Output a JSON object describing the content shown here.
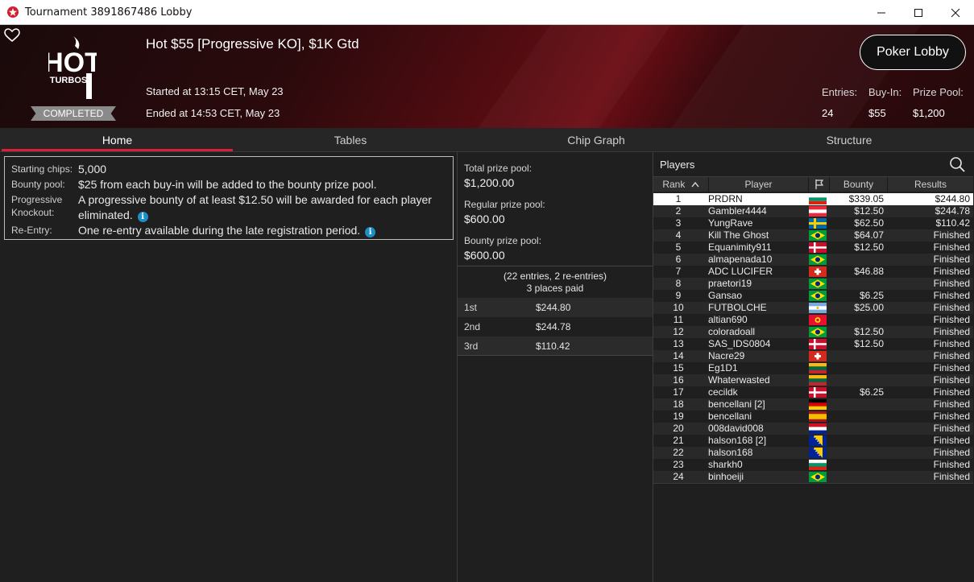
{
  "window": {
    "title": "Tournament 3891867486 Lobby"
  },
  "header": {
    "logo_top": "HOT",
    "logo_bottom": "TURBOS",
    "status_badge": "COMPLETED",
    "tournament_name": "Hot $55 [Progressive KO], $1K Gtd",
    "started": "Started at 13:15 CET, May 23",
    "ended": "Ended at 14:53 CET, May 23",
    "lobby_button": "Poker Lobby",
    "stats": {
      "entries_label": "Entries:",
      "entries_value": "24",
      "buyin_label": "Buy-In:",
      "buyin_value": "$55",
      "prizepool_label": "Prize Pool:",
      "prizepool_value": "$1,200"
    }
  },
  "tabs": [
    "Home",
    "Tables",
    "Chip Graph",
    "Structure"
  ],
  "info": {
    "starting_chips_label": "Starting chips:",
    "starting_chips_value": "5,000",
    "bounty_pool_label": "Bounty pool:",
    "bounty_pool_value": "$25 from each buy-in will be added to the bounty prize pool.",
    "progressive_label_1": "Progressive",
    "progressive_label_2": "Knockout:",
    "progressive_value_1": "A progressive bounty of at least $12.50 will be awarded for each player",
    "progressive_value_2": "eliminated.",
    "reentry_label": "Re-Entry:",
    "reentry_value": "One re-entry available during the late registration period."
  },
  "prize": {
    "total_label": "Total prize pool:",
    "total_value": "$1,200.00",
    "regular_label": "Regular prize pool:",
    "regular_value": "$600.00",
    "bounty_label": "Bounty prize pool:",
    "bounty_value": "$600.00",
    "entries_note": "(22 entries, 2 re-entries)",
    "places_note": "3 places paid",
    "payouts": [
      {
        "place": "1st",
        "amount": "$244.80"
      },
      {
        "place": "2nd",
        "amount": "$244.78"
      },
      {
        "place": "3rd",
        "amount": "$110.42"
      }
    ]
  },
  "players": {
    "title": "Players",
    "columns": {
      "rank": "Rank",
      "player": "Player",
      "bounty": "Bounty",
      "results": "Results"
    },
    "rows": [
      {
        "rank": "1",
        "name": "PRDRN",
        "flag": "bg",
        "bounty": "$339.05",
        "result": "$244.80"
      },
      {
        "rank": "2",
        "name": "Gambler4444",
        "flag": "at",
        "bounty": "$12.50",
        "result": "$244.78"
      },
      {
        "rank": "3",
        "name": "YungRave",
        "flag": "se",
        "bounty": "$62.50",
        "result": "$110.42"
      },
      {
        "rank": "4",
        "name": "Kill The Ghost",
        "flag": "br",
        "bounty": "$64.07",
        "result": "Finished"
      },
      {
        "rank": "5",
        "name": "Equanimity911",
        "flag": "dk",
        "bounty": "$12.50",
        "result": "Finished"
      },
      {
        "rank": "6",
        "name": "almapenada10",
        "flag": "br",
        "bounty": "",
        "result": "Finished"
      },
      {
        "rank": "7",
        "name": "ADC LUCIFER",
        "flag": "ch",
        "bounty": "$46.88",
        "result": "Finished"
      },
      {
        "rank": "8",
        "name": "praetori19",
        "flag": "br",
        "bounty": "",
        "result": "Finished"
      },
      {
        "rank": "9",
        "name": "Gansao",
        "flag": "br",
        "bounty": "$6.25",
        "result": "Finished"
      },
      {
        "rank": "10",
        "name": "FUTBOLCHE",
        "flag": "ar",
        "bounty": "$25.00",
        "result": "Finished"
      },
      {
        "rank": "11",
        "name": "altian690",
        "flag": "kg",
        "bounty": "",
        "result": "Finished"
      },
      {
        "rank": "12",
        "name": "coloradoall",
        "flag": "br",
        "bounty": "$12.50",
        "result": "Finished"
      },
      {
        "rank": "13",
        "name": "SAS_IDS0804",
        "flag": "dk",
        "bounty": "$12.50",
        "result": "Finished"
      },
      {
        "rank": "14",
        "name": "Nacre29",
        "flag": "ch",
        "bounty": "",
        "result": "Finished"
      },
      {
        "rank": "15",
        "name": "Eg1D1",
        "flag": "lt",
        "bounty": "",
        "result": "Finished"
      },
      {
        "rank": "16",
        "name": "Whaterwasted",
        "flag": "lt",
        "bounty": "",
        "result": "Finished"
      },
      {
        "rank": "17",
        "name": "cecildk",
        "flag": "dk",
        "bounty": "$6.25",
        "result": "Finished"
      },
      {
        "rank": "18",
        "name": "bencellani [2]",
        "flag": "de",
        "bounty": "",
        "result": "Finished"
      },
      {
        "rank": "19",
        "name": "bencellani",
        "flag": "es",
        "bounty": "",
        "result": "Finished"
      },
      {
        "rank": "20",
        "name": "008david008",
        "flag": "mixed",
        "bounty": "",
        "result": "Finished"
      },
      {
        "rank": "21",
        "name": "halson168 [2]",
        "flag": "ba",
        "bounty": "",
        "result": "Finished"
      },
      {
        "rank": "22",
        "name": "halson168",
        "flag": "ba",
        "bounty": "",
        "result": "Finished"
      },
      {
        "rank": "23",
        "name": "sharkh0",
        "flag": "bg",
        "bounty": "",
        "result": "Finished"
      },
      {
        "rank": "24",
        "name": "binhoeiji",
        "flag": "br",
        "bounty": "",
        "result": "Finished"
      }
    ]
  },
  "colors": {
    "accent_red": "#d8203b",
    "info_blue": "#1d8fc7",
    "header_dark": "#1a0a0b",
    "header_red": "#6d0e15"
  }
}
